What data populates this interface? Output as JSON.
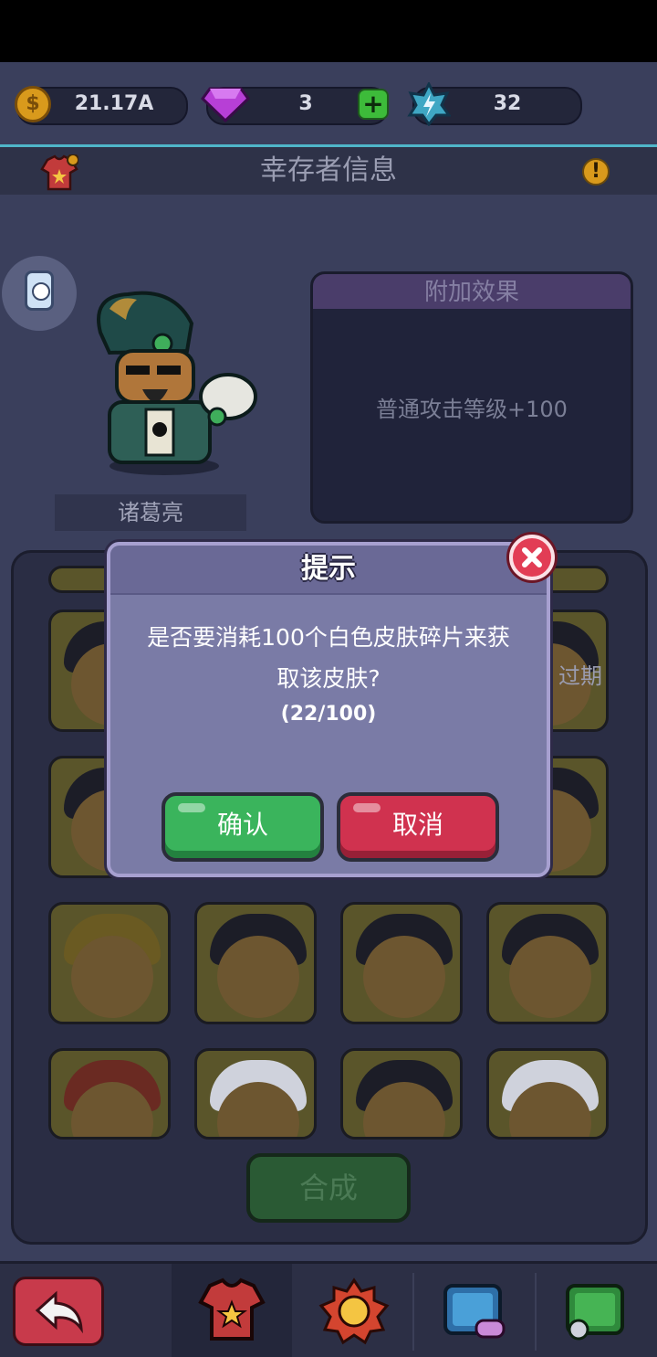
{
  "currency": {
    "coins": "21.17A",
    "coin_icon_glyph": "$",
    "gems": "3",
    "energy": "32",
    "plus_label": "+"
  },
  "header": {
    "title": "幸存者信息",
    "info_glyph": "!"
  },
  "character": {
    "name": "诸葛亮"
  },
  "effect": {
    "title": "附加效果",
    "text": "普通攻击等级+100"
  },
  "skins": {
    "partial_label": "过期"
  },
  "craft_button": "合成",
  "dialog": {
    "title": "提示",
    "message": "是否要消耗100个白色皮肤碎片来获取该皮肤?",
    "progress": "(22/100)",
    "confirm": "确认",
    "cancel": "取消"
  },
  "colors": {
    "background": "#3a3f5c",
    "dialog": "#7a7ba6",
    "confirm": "#3ab45c",
    "cancel": "#d0324f",
    "accent_line": "#4fb6c9"
  },
  "icons": [
    "coin-icon",
    "gem-icon",
    "energy-icon",
    "shirt-icon",
    "info-icon",
    "close-icon",
    "back-icon",
    "badge-icon",
    "game-icon",
    "portrait-icon"
  ]
}
